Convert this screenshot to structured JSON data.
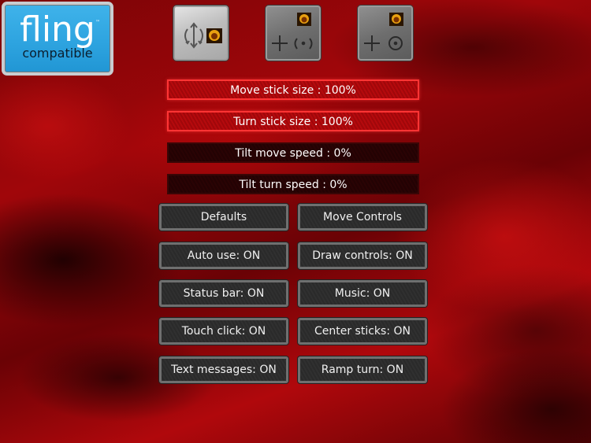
{
  "logo": {
    "main": "fling",
    "trademark": "™",
    "sub": "compatible"
  },
  "control_modes": [
    {
      "name": "tilt-mode",
      "state": "active",
      "icons": [
        "rotate-arrows-icon",
        "fire-button-icon"
      ]
    },
    {
      "name": "move-turn-sticks-mode",
      "state": "inactive",
      "icons": [
        "move-cross-icon",
        "turn-arrows-icon",
        "fire-button-icon"
      ]
    },
    {
      "name": "move-stick-circle-mode",
      "state": "inactive",
      "icons": [
        "move-cross-icon",
        "circle-stick-icon",
        "fire-button-icon"
      ]
    }
  ],
  "sliders": [
    {
      "label": "Move stick size : 100%",
      "value_percent": 100,
      "state": "on"
    },
    {
      "label": "Turn stick size : 100%",
      "value_percent": 100,
      "state": "on"
    },
    {
      "label": "Tilt move speed : 0%",
      "value_percent": 0,
      "state": "off"
    },
    {
      "label": "Tilt turn speed : 0%",
      "value_percent": 0,
      "state": "off"
    }
  ],
  "buttons": {
    "defaults": "Defaults",
    "move_controls": "Move Controls",
    "auto_use": "Auto use: ON",
    "draw_controls": "Draw controls: ON",
    "status_bar": "Status bar: ON",
    "music": "Music: ON",
    "touch_click": "Touch click: ON",
    "center_sticks": "Center sticks: ON",
    "text_messages": "Text messages: ON",
    "ramp_turn": "Ramp turn: ON"
  },
  "colors": {
    "slider_active_border": "#ff3434",
    "logo_blue": "#2ea4e0",
    "button_border": "#6f6f6f"
  }
}
